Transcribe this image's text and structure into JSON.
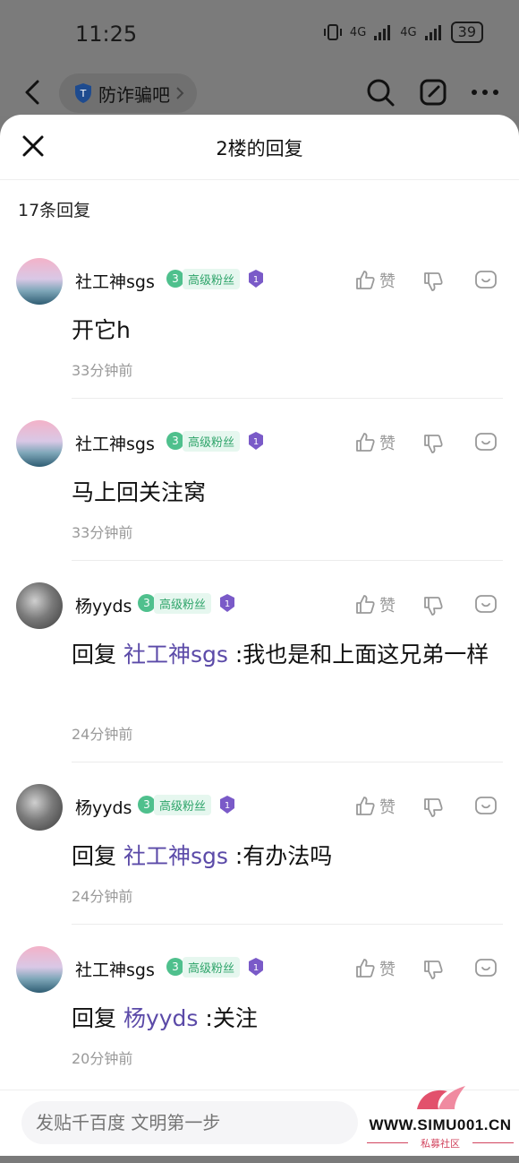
{
  "status_bar": {
    "time": "11:25",
    "signal_1": "4G",
    "signal_2": "4G",
    "battery": "39"
  },
  "top_bar": {
    "forum_name": "防诈骗吧"
  },
  "sheet": {
    "title": "2楼的回复",
    "reply_count": "17条回复"
  },
  "like_label": "赞",
  "replies": [
    {
      "user": "社工神sgs",
      "level": "3",
      "fan_label": "高级粉丝",
      "content": "开它h",
      "mention": "",
      "time": "33分钟前"
    },
    {
      "user": "社工神sgs",
      "level": "3",
      "fan_label": "高级粉丝",
      "content": "马上回关注窝",
      "mention": "",
      "time": "33分钟前"
    },
    {
      "user": "杨yyds",
      "level": "3",
      "fan_label": "高级粉丝",
      "prefix": "回复",
      "mention": "社工神sgs",
      "content": ":我也是和上面这兄弟一样",
      "time": "24分钟前"
    },
    {
      "user": "杨yyds",
      "level": "3",
      "fan_label": "高级粉丝",
      "prefix": "回复",
      "mention": "社工神sgs",
      "content": ":有办法吗",
      "time": "24分钟前"
    },
    {
      "user": "社工神sgs",
      "level": "3",
      "fan_label": "高级粉丝",
      "prefix": "回复",
      "mention": "杨yyds",
      "content": ":关注",
      "time": "20分钟前"
    }
  ],
  "bottom_bar": {
    "input_placeholder": "发贴千百度 文明第一步"
  },
  "watermark": {
    "text": "WWW.SIMU001.CN",
    "sub": "私募社区"
  }
}
